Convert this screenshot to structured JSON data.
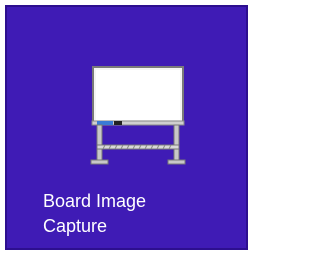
{
  "tile": {
    "label_line1": "Board Image",
    "label_line2": "Capture",
    "icon": "whiteboard-icon",
    "background_color": "#3f1bb5"
  }
}
